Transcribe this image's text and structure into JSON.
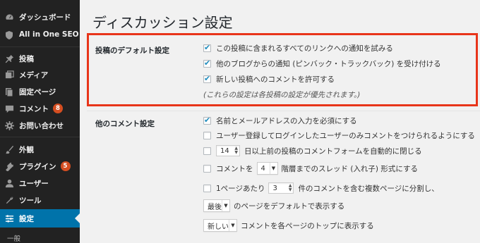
{
  "sidebar": {
    "items": [
      {
        "label": "ダッシュボード",
        "icon": "dashboard-icon"
      },
      {
        "label": "All in One SEO",
        "icon": "seo-icon"
      },
      {
        "label": "投稿",
        "icon": "pin-icon"
      },
      {
        "label": "メディア",
        "icon": "media-icon"
      },
      {
        "label": "固定ページ",
        "icon": "page-icon"
      },
      {
        "label": "コメント",
        "icon": "comment-icon",
        "badge": "8"
      },
      {
        "label": "お問い合わせ",
        "icon": "contact-icon"
      },
      {
        "label": "外観",
        "icon": "appearance-icon"
      },
      {
        "label": "プラグイン",
        "icon": "plugin-icon",
        "badge": "5"
      },
      {
        "label": "ユーザー",
        "icon": "user-icon"
      },
      {
        "label": "ツール",
        "icon": "tool-icon"
      },
      {
        "label": "設定",
        "icon": "settings-icon",
        "active": true
      }
    ],
    "submenu_first": "一般",
    "badge_color": "#d54e21",
    "active_color": "#0073aa"
  },
  "main": {
    "title": "ディスカッション設定",
    "default_section": {
      "label": "投稿のデフォルト設定",
      "options": [
        {
          "text": "この投稿に含まれるすべてのリンクへの通知を試みる",
          "checked": true
        },
        {
          "text": "他のブログからの通知 (ピンバック・トラックバック) を受け付ける",
          "checked": true
        },
        {
          "text": "新しい投稿へのコメントを許可する",
          "checked": true
        }
      ],
      "note": "(これらの設定は各投稿の設定が優先されます。)"
    },
    "other_section": {
      "label": "他のコメント設定",
      "opt_name_email": "名前とメールアドレスの入力を必須にする",
      "opt_registered": "ユーザー登録してログインしたユーザーのみコメントをつけられるようにする",
      "close_days": "14",
      "opt_close_after": "日以上前の投稿のコメントフォームを自動的に閉じる",
      "opt_threaded_prefix": "コメントを",
      "thread_depth": "4",
      "opt_threaded_suffix": "階層までのスレッド (入れ子) 形式にする",
      "opt_paged_prefix": "1ページあたり",
      "per_page": "3",
      "opt_paged_suffix": "件のコメントを含む複数ページに分割し、",
      "default_page_select": "最後",
      "default_page_suffix": "のページをデフォルトで表示する",
      "order_select": "新しい",
      "order_suffix": "コメントを各ページのトップに表示する"
    },
    "highlight_color": "#e8351a"
  }
}
